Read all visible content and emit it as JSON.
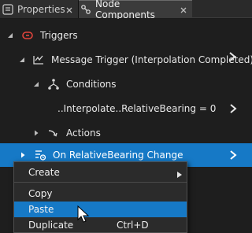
{
  "tabs": [
    {
      "label": "Properties",
      "active": false
    },
    {
      "label": "Node Components",
      "active": true
    }
  ],
  "tree": {
    "triggers": {
      "label": "Triggers",
      "icon": "trigger-icon"
    },
    "message_trigger": {
      "label": "Message Trigger (Interpolation Completed)",
      "icon": "message-trigger-icon"
    },
    "conditions": {
      "label": "Conditions",
      "icon": "conditions-icon"
    },
    "condition_value": {
      "label": "..Interpolate..RelativeBearing = 0"
    },
    "actions": {
      "label": "Actions",
      "icon": "actions-icon"
    },
    "on_change": {
      "label": "On RelativeBearing Change",
      "icon": "property-trigger-icon"
    }
  },
  "context_menu": {
    "create": "Create",
    "copy": "Copy",
    "paste": "Paste",
    "duplicate": "Duplicate",
    "duplicate_shortcut": "Ctrl+D"
  },
  "colors": {
    "selection": "#1679c6",
    "trigger_red": "#e0443c",
    "background": "#1e1e1e"
  }
}
